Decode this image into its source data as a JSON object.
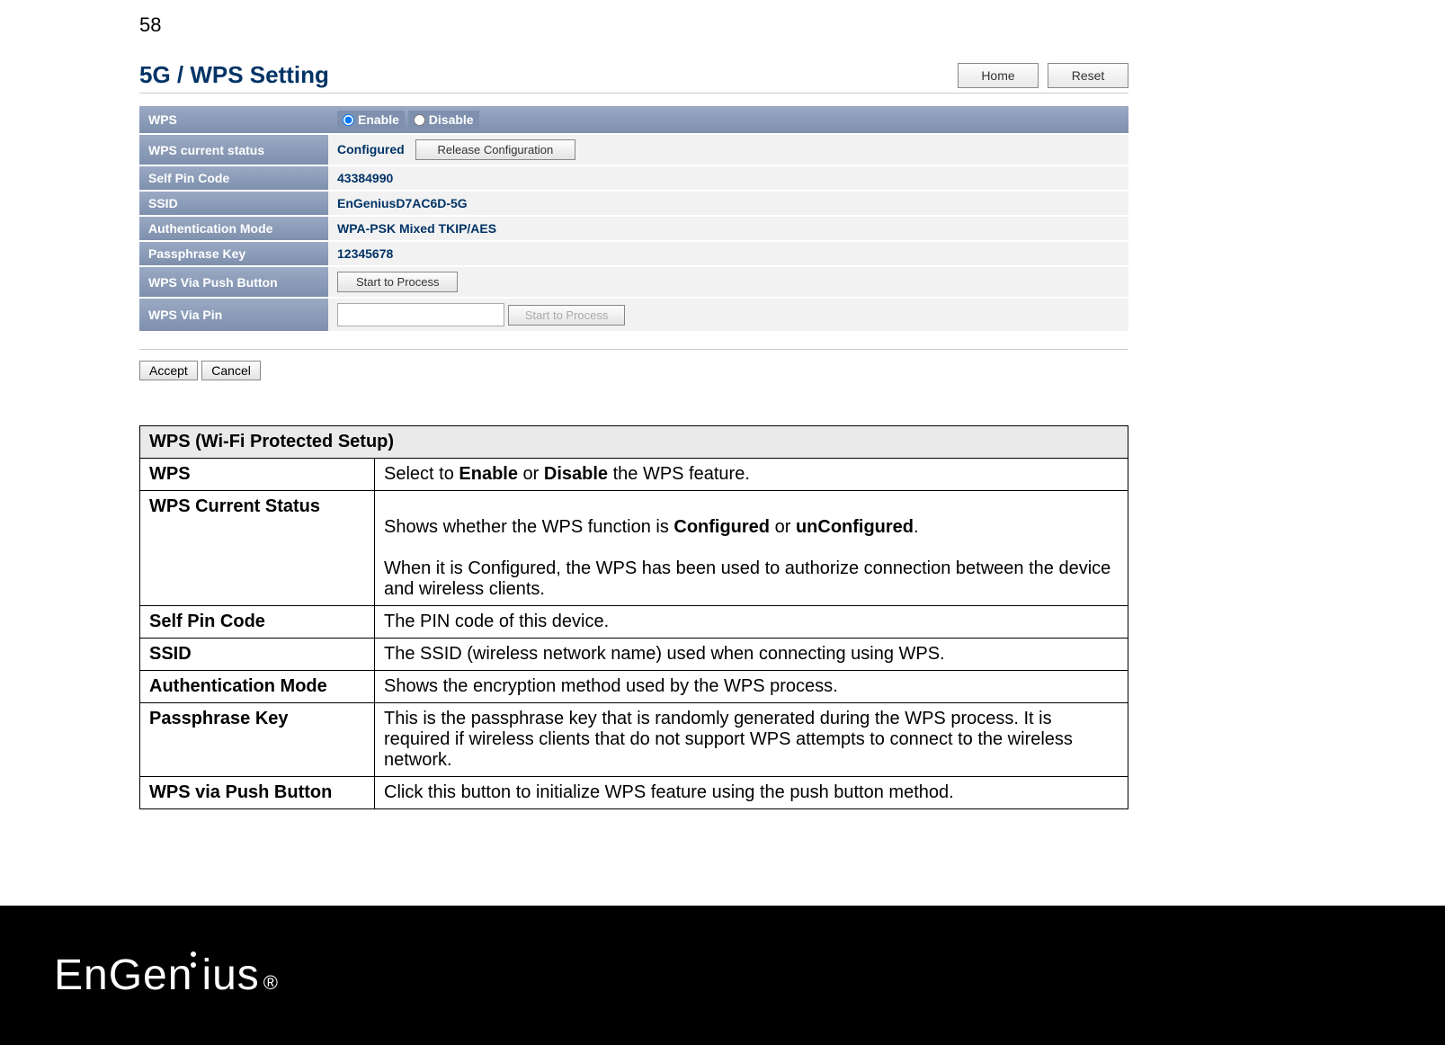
{
  "page_number": "58",
  "panel": {
    "title": "5G / WPS Setting",
    "home_btn": "Home",
    "reset_btn": "Reset"
  },
  "settings": {
    "wps_label": "WPS",
    "wps_enable": "Enable",
    "wps_disable": "Disable",
    "current_status_label": "WPS current status",
    "current_status_value": "Configured",
    "release_btn": "Release Configuration",
    "self_pin_label": "Self Pin Code",
    "self_pin_value": "43384990",
    "ssid_label": "SSID",
    "ssid_value": "EnGeniusD7AC6D-5G",
    "auth_label": "Authentication Mode",
    "auth_value": "WPA-PSK Mixed TKIP/AES",
    "pass_label": "Passphrase Key",
    "pass_value": "12345678",
    "push_label": "WPS Via Push Button",
    "push_btn": "Start to Process",
    "pin_label": "WPS Via Pin",
    "pin_btn": "Start to Process",
    "accept_btn": "Accept",
    "cancel_btn": "Cancel"
  },
  "doc": {
    "header": "WPS (Wi-Fi Protected Setup)",
    "rows": [
      {
        "term": "WPS",
        "desc_parts": [
          "Select to ",
          "Enable",
          " or ",
          "Disable",
          " the WPS feature."
        ]
      },
      {
        "term": "WPS Current Status",
        "desc_parts": [
          "Shows whether the WPS function is ",
          "Configured",
          " or ",
          "unConfigured",
          ".\n\nWhen it is Configured, the WPS has been used to authorize connection between the device and wireless clients."
        ]
      },
      {
        "term": "Self Pin Code",
        "desc": "The PIN code of this device."
      },
      {
        "term": "SSID",
        "desc": "The SSID (wireless network name) used when connecting using WPS."
      },
      {
        "term": "Authentication Mode",
        "desc": "Shows the encryption method used by the WPS process."
      },
      {
        "term": "Passphrase Key",
        "desc": "This is the passphrase key that is randomly generated during the WPS process. It is required if wireless clients that do not support WPS attempts to connect to the wireless network."
      },
      {
        "term": "WPS via Push Button",
        "desc": "Click this button to initialize WPS feature using the push button method."
      }
    ]
  },
  "logo": {
    "text1": "EnGen",
    "text2": "ius"
  }
}
